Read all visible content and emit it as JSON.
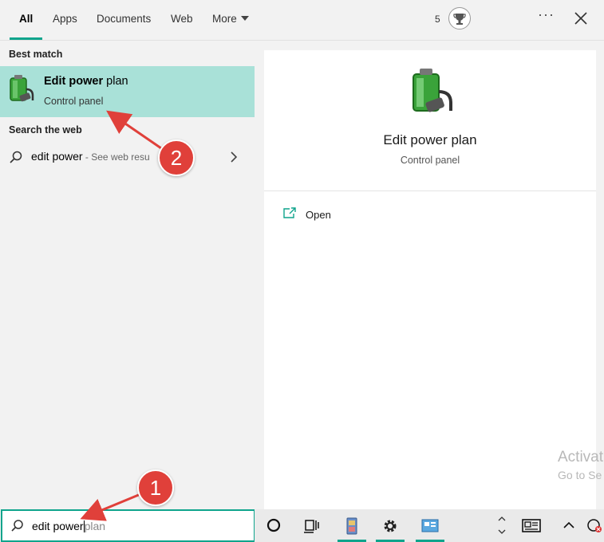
{
  "tabs": [
    {
      "label": "All",
      "active": true
    },
    {
      "label": "Apps",
      "active": false
    },
    {
      "label": "Documents",
      "active": false
    },
    {
      "label": "Web",
      "active": false
    },
    {
      "label": "More",
      "active": false
    }
  ],
  "header": {
    "rewards_count": "5",
    "ellipsis": "···",
    "accent_color": "#0fa48c"
  },
  "results": {
    "best_match_heading": "Best match",
    "best_match": {
      "title_bold": "Edit power",
      "title_rest": " plan",
      "subtitle": "Control panel",
      "icon": "power-plan-battery-icon",
      "highlight_color": "#a9e1d8"
    },
    "web_heading": "Search the web",
    "web_item": {
      "query": "edit power",
      "hint": " - See web resu"
    }
  },
  "preview": {
    "title": "Edit power plan",
    "subtitle": "Control panel",
    "actions": [
      {
        "label": "Open",
        "icon": "open-window-icon"
      }
    ]
  },
  "watermark": {
    "line1": "Activat",
    "line2": "Go to Se"
  },
  "search": {
    "typed": "edit power",
    "suggestion": "plan"
  },
  "taskbar": {
    "items": [
      "cortana-icon",
      "task-view-icon",
      "app-icon",
      "settings-icon",
      "control-panel-icon"
    ],
    "tray": [
      "scroll-arrows-icon",
      "news-icon",
      "chevron-up-icon",
      "network-icon"
    ]
  },
  "annotations": [
    {
      "label": "1",
      "color": "#e0403a"
    },
    {
      "label": "2",
      "color": "#e0403a"
    }
  ]
}
